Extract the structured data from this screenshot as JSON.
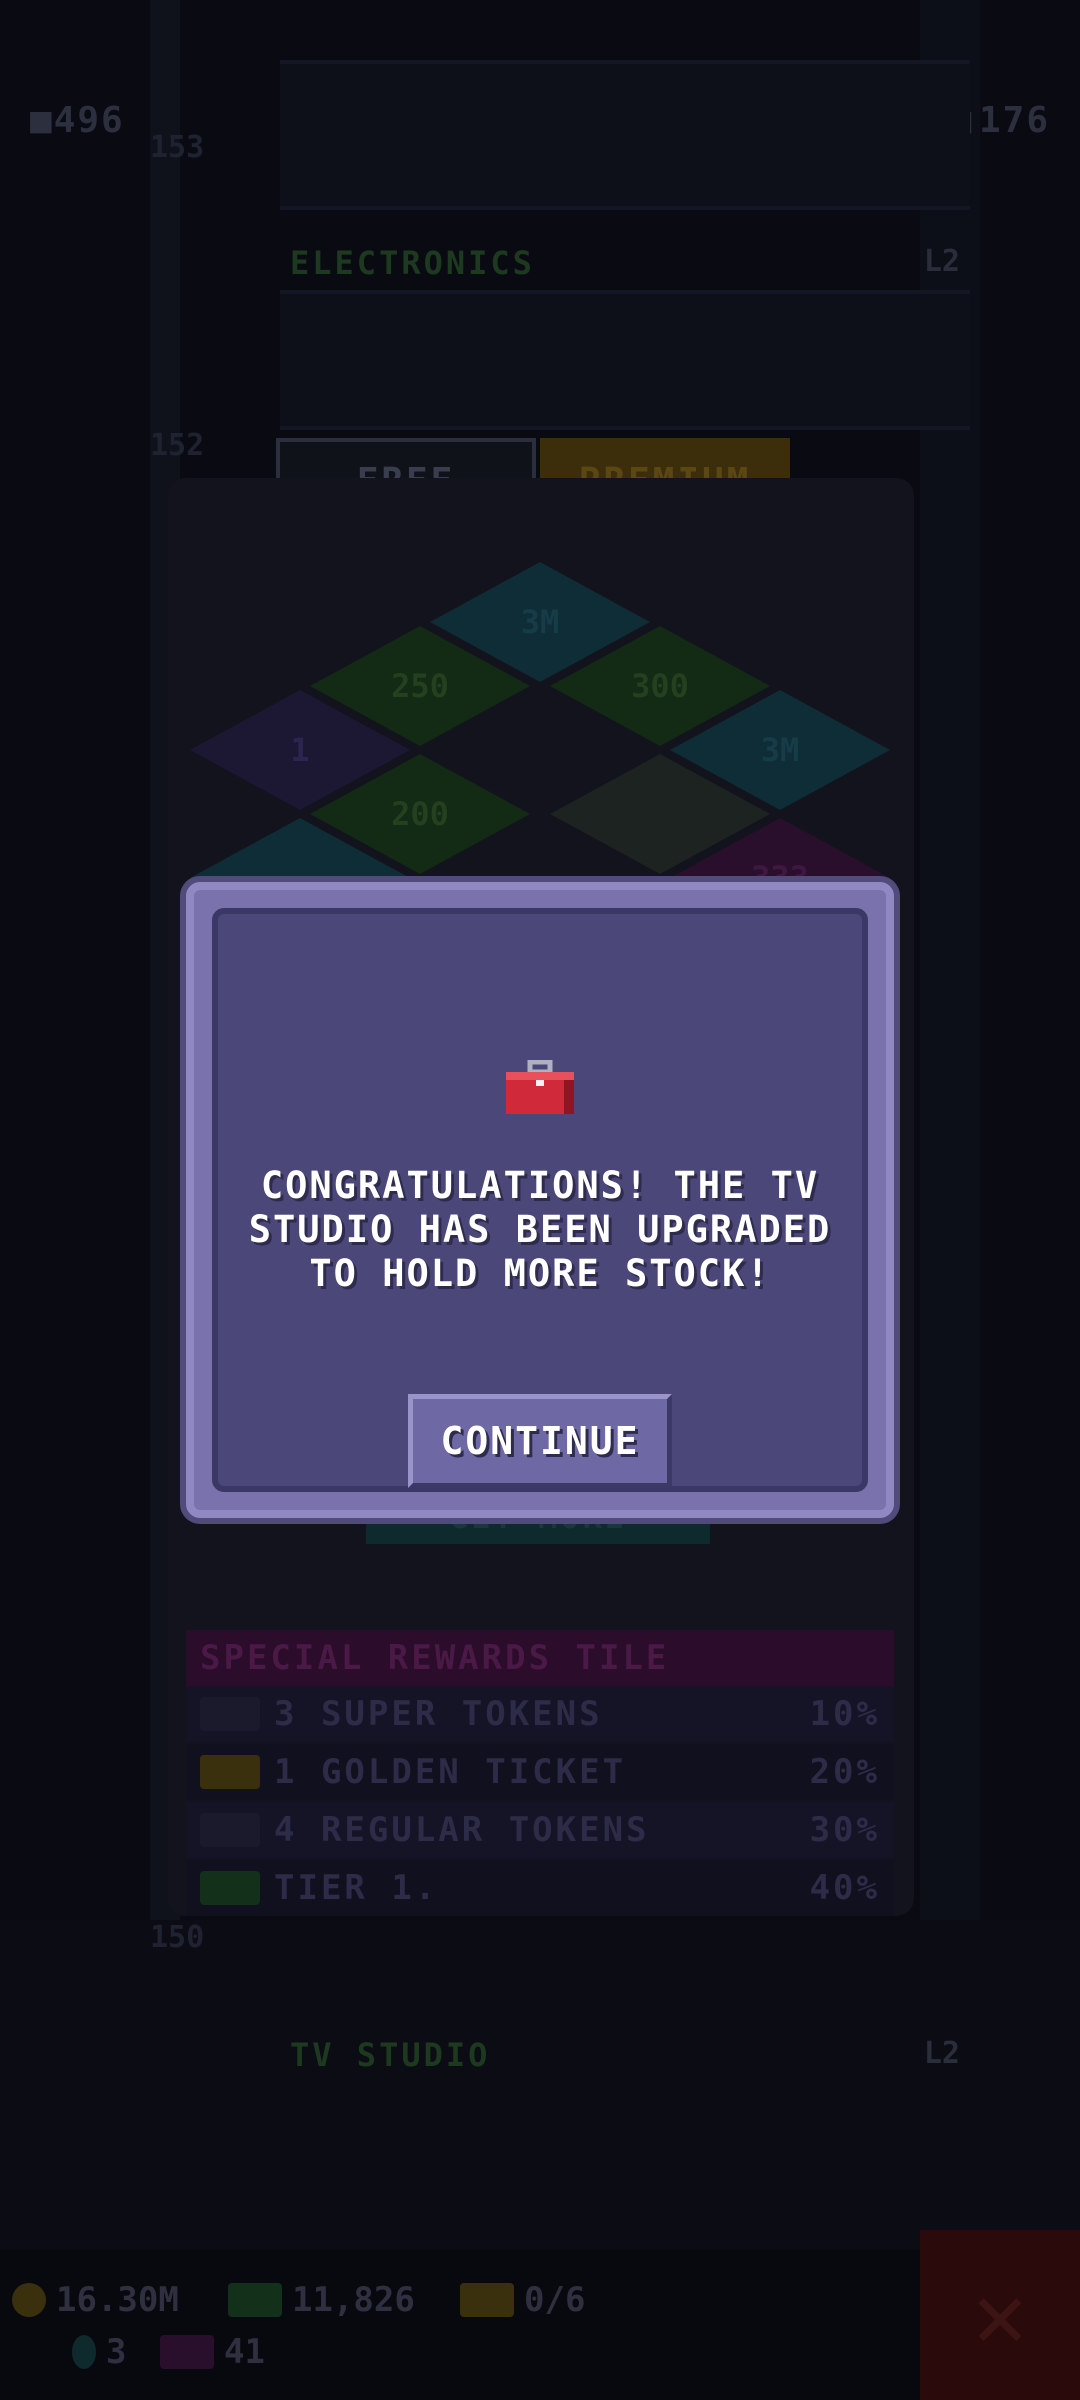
{
  "hud_top": {
    "left_value": "496",
    "right_value": "176",
    "side_value_a": "153",
    "side_value_b": "152",
    "side_value_c": "150"
  },
  "background_floors": {
    "floor_a_label": "ELECTRONICS",
    "floor_b_label": "TV STUDIO",
    "level_label": "L2"
  },
  "reward_tabs": {
    "free": "FREE",
    "premium": "PREMIUM"
  },
  "board_tiles": [
    {
      "label": "3M",
      "color": "blue"
    },
    {
      "label": "250",
      "color": "green"
    },
    {
      "label": "300",
      "color": "green"
    },
    {
      "label": "1",
      "color": "purple"
    },
    {
      "label": "3M",
      "color": "blue"
    },
    {
      "label": "200",
      "color": "green"
    },
    {
      "label": "",
      "color": "white"
    },
    {
      "label": "333",
      "color": "magenta"
    },
    {
      "label": "",
      "color": "blue"
    }
  ],
  "button_behind": "GET MORE",
  "special_rewards": {
    "title": "SPECIAL REWARDS TILE",
    "rows": [
      {
        "label": "3 SUPER TOKENS",
        "chance": "10%",
        "icon": "key-icon"
      },
      {
        "label": "1 GOLDEN TICKET",
        "chance": "20%",
        "icon": "ticket-icon"
      },
      {
        "label": "4 REGULAR TOKENS",
        "chance": "30%",
        "icon": "key-icon"
      },
      {
        "label": "TIER 1.",
        "chance": "40%",
        "icon": "cash-icon"
      }
    ]
  },
  "bottom_hud": {
    "coins": "16.30M",
    "bux": "11,826",
    "tickets": "0/6",
    "gems": "3",
    "tv": "41"
  },
  "modal": {
    "icon": "toolbox-icon",
    "message": "CONGRATULATIONS! THE TV STUDIO HAS BEEN UPGRADED TO HOLD MORE STOCK!",
    "message_lines": [
      "CONGRATULATIONS! THE TV",
      "STUDIO HAS BEEN UPGRADED",
      "TO HOLD MORE STOCK!"
    ],
    "continue_label": "CONTINUE"
  },
  "colors": {
    "modal_border": "#7a72ac",
    "modal_fill": "#4b4778",
    "button_fill": "#6e68a4",
    "toolbox_red": "#d0293a"
  }
}
